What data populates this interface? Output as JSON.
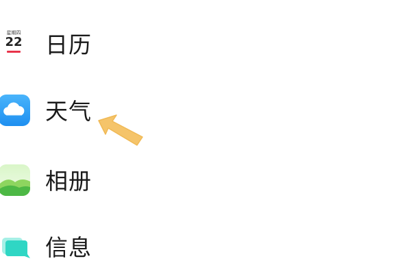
{
  "apps": [
    {
      "id": "calendar",
      "label": "日历",
      "icon": "calendar-icon",
      "weekday": "星期四",
      "day": "22",
      "accent": "#e8334a"
    },
    {
      "id": "weather",
      "label": "天气",
      "icon": "weather-icon",
      "accent": "#3aa0f3"
    },
    {
      "id": "gallery",
      "label": "相册",
      "icon": "gallery-icon",
      "accent": "#5cc35f"
    },
    {
      "id": "messages",
      "label": "信息",
      "icon": "message-icon",
      "accent": "#2fd6c4"
    }
  ],
  "annotation": {
    "icon": "pointer-arrow-icon",
    "color": "#f5c46a",
    "target": "weather"
  }
}
